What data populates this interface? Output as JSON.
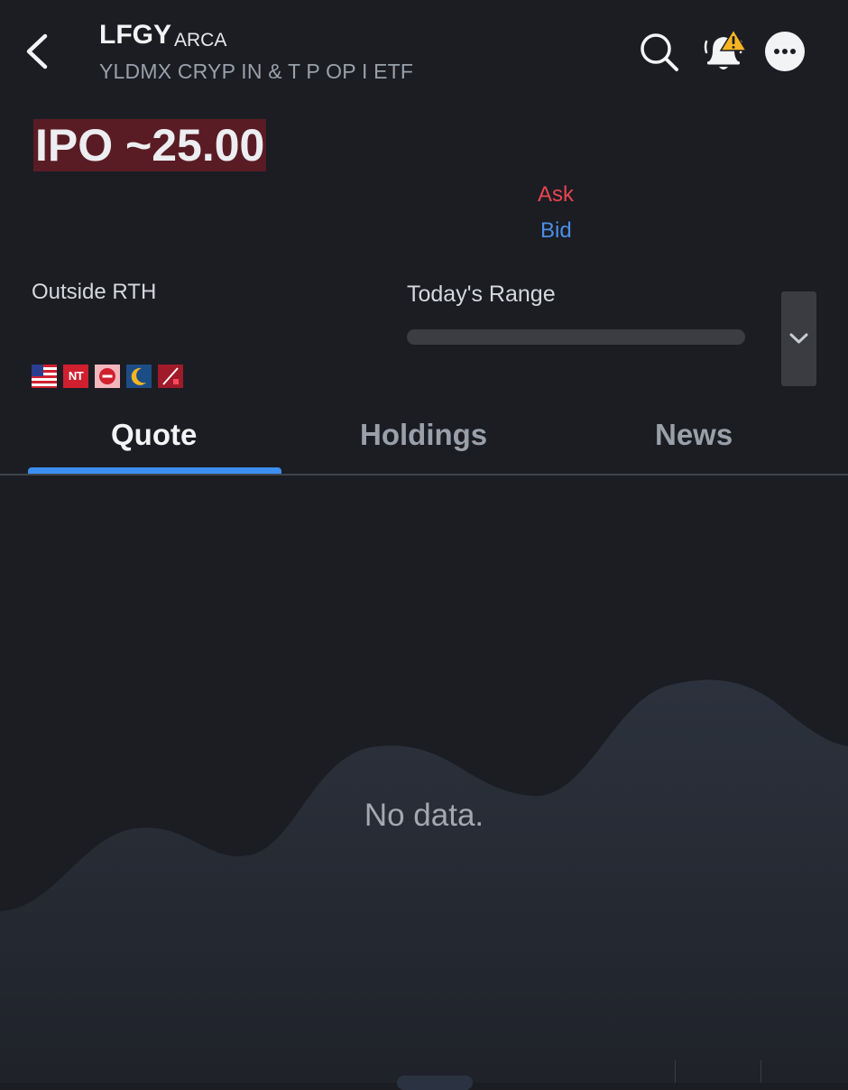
{
  "header": {
    "symbol": "LFGY",
    "exchange": "ARCA",
    "full_name": "YLDMX CRYP IN & T P OP I ETF",
    "icons": [
      "back-arrow-icon",
      "search-icon",
      "bell-alert-icon",
      "more-icon"
    ],
    "alert_badge_color": "#f5b523"
  },
  "quote": {
    "price_text": "IPO ~25.00",
    "price_bg_color": "#5a1c24",
    "ask_label": "Ask",
    "bid_label": "Bid",
    "ask_color": "#e8454f",
    "bid_color": "#4a90e8",
    "session_label": "Outside RTH",
    "range_label": "Today's Range",
    "badges": [
      {
        "name": "us-flag-icon"
      },
      {
        "name": "nt-badge",
        "text": "NT"
      },
      {
        "name": "halt-icon"
      },
      {
        "name": "overnight-moon-icon"
      },
      {
        "name": "no-short-icon"
      }
    ]
  },
  "tabs": [
    {
      "label": "Quote",
      "active": true
    },
    {
      "label": "Holdings",
      "active": false
    },
    {
      "label": "News",
      "active": false
    }
  ],
  "accent_color": "#3c8ef0",
  "empty_state": {
    "message": "No data."
  }
}
